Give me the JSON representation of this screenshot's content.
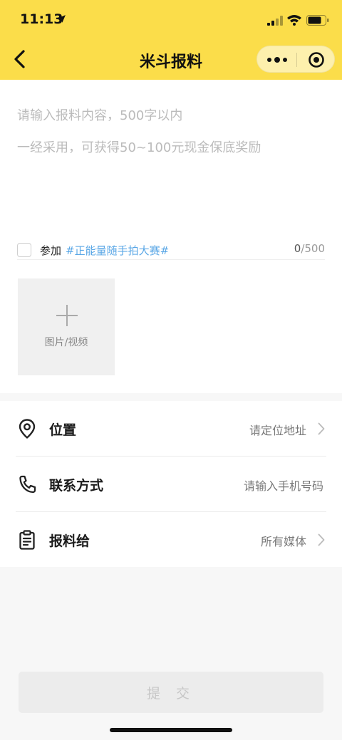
{
  "status_bar": {
    "time": "11:13"
  },
  "nav": {
    "title": "米斗报料"
  },
  "editor": {
    "placeholder_line1": "请输入报料内容，500字以内",
    "placeholder_line2": "一经采用，可获得50~100元现金保底奖励"
  },
  "topic": {
    "join_label": "参加",
    "tag": "#正能量随手拍大赛#",
    "count_current": "0",
    "count_max": "/500"
  },
  "upload": {
    "label": "图片/视频"
  },
  "form": {
    "location": {
      "label": "位置",
      "value": "请定位地址"
    },
    "contact": {
      "label": "联系方式",
      "placeholder": "请输入手机号码"
    },
    "recipient": {
      "label": "报料给",
      "value": "所有媒体"
    }
  },
  "submit_label": "提 交",
  "colors": {
    "header": "#fbdd4a",
    "topic_tag": "#5aa7e6",
    "submit_bg": "#ececec"
  },
  "icons": [
    "location-pin-icon",
    "phone-icon",
    "clipboard-icon",
    "chevron-right-icon",
    "back-icon",
    "more-icon",
    "close-target-icon"
  ]
}
